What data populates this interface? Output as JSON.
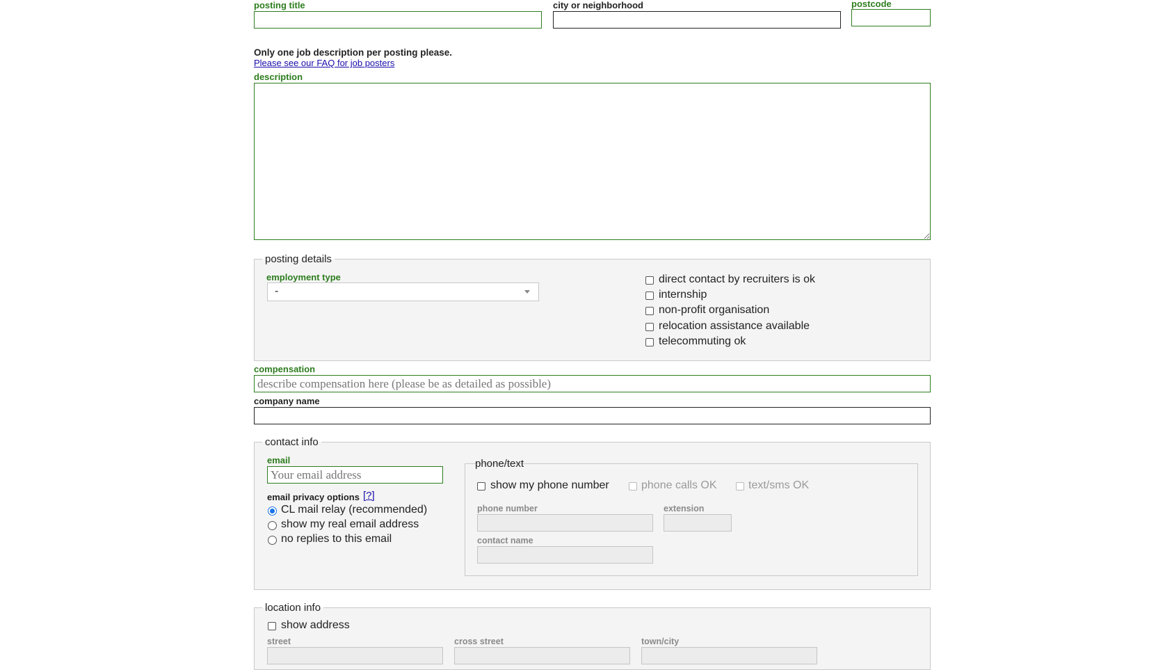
{
  "fields": {
    "posting_title_label": "posting title",
    "city_label": "city or neighborhood",
    "postcode_label": "postcode",
    "notice": "Only one job description per posting please.",
    "faq_link": "Please see our FAQ for job posters",
    "description_label": "description",
    "compensation_label": "compensation",
    "compensation_placeholder": "describe compensation here (please be as detailed as possible)",
    "company_name_label": "company name"
  },
  "posting_details": {
    "legend": "posting details",
    "employment_type_label": "employment type",
    "employment_type_value": "-",
    "checkboxes": [
      "direct contact by recruiters is ok",
      "internship",
      "non-profit organisation",
      "relocation assistance available",
      "telecommuting ok"
    ]
  },
  "contact_info": {
    "legend": "contact info",
    "email_label": "email",
    "email_placeholder": "Your email address",
    "privacy_label": "email privacy options",
    "privacy_help": "[?]",
    "privacy_options": [
      "CL mail relay (recommended)",
      "show my real email address",
      "no replies to this email"
    ],
    "privacy_selected": "CL mail relay (recommended)",
    "phone": {
      "legend": "phone/text",
      "show_phone": "show my phone number",
      "calls_ok": "phone calls OK",
      "sms_ok": "text/sms OK",
      "phone_number_label": "phone number",
      "extension_label": "extension",
      "contact_name_label": "contact name"
    }
  },
  "location_info": {
    "legend": "location info",
    "show_address": "show address",
    "street_label": "street",
    "cross_street_label": "cross street",
    "town_city_label": "town/city"
  }
}
